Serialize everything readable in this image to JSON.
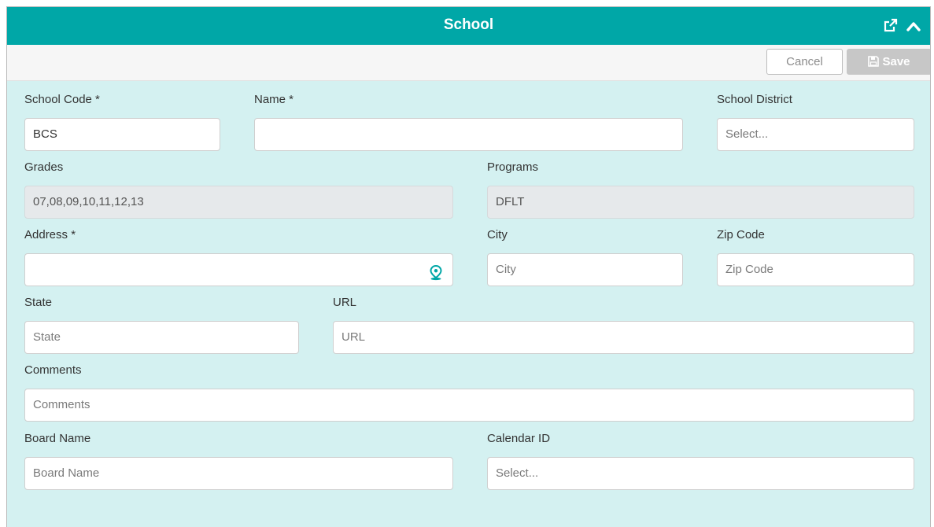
{
  "header": {
    "title": "School",
    "external_icon": "external-link-icon",
    "collapse_icon": "chevron-up-icon"
  },
  "toolbar": {
    "cancel_label": "Cancel",
    "save_label": "Save",
    "save_icon": "save-icon"
  },
  "form": {
    "school_code": {
      "label": "School Code *",
      "value": "BCS"
    },
    "name": {
      "label": "Name *",
      "value": ""
    },
    "school_district": {
      "label": "School District",
      "placeholder": "Select..."
    },
    "grades": {
      "label": "Grades",
      "value": "07,08,09,10,11,12,13"
    },
    "programs": {
      "label": "Programs",
      "value": "DFLT"
    },
    "address": {
      "label": "Address *",
      "value": "",
      "icon": "map-pin-icon"
    },
    "city": {
      "label": "City",
      "placeholder": "City"
    },
    "zip_code": {
      "label": "Zip Code",
      "placeholder": "Zip Code"
    },
    "state": {
      "label": "State",
      "placeholder": "State"
    },
    "url": {
      "label": "URL",
      "placeholder": "URL"
    },
    "comments": {
      "label": "Comments",
      "placeholder": "Comments"
    },
    "board_name": {
      "label": "Board Name",
      "placeholder": "Board Name"
    },
    "calendar_id": {
      "label": "Calendar ID",
      "placeholder": "Select..."
    }
  },
  "colors": {
    "header_bg": "#00a7a7",
    "panel_bg": "#d4f1f1",
    "accent": "#00a7a7"
  }
}
